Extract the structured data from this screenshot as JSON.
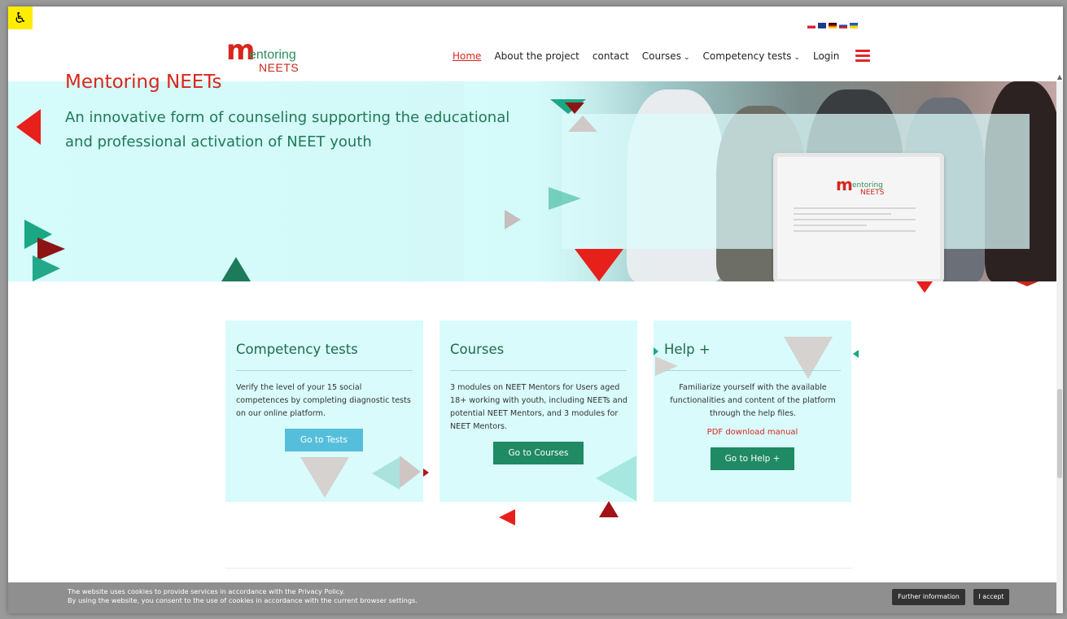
{
  "accessibility": {
    "icon": "wheelchair-icon",
    "glyph": "♿"
  },
  "languages": [
    "pl",
    "gb",
    "de",
    "ru",
    "ua"
  ],
  "logo": {
    "m": "m",
    "line1": "entoring",
    "line2": "NEETS"
  },
  "nav": {
    "items": [
      {
        "label": "Home",
        "active": true
      },
      {
        "label": "About the project"
      },
      {
        "label": "contact"
      },
      {
        "label": "Courses",
        "dropdown": true
      },
      {
        "label": "Competency tests",
        "dropdown": true
      },
      {
        "label": "Login"
      }
    ],
    "chevron": "⌄"
  },
  "hero": {
    "title": "Mentoring NEETs",
    "subtitle": "An innovative form of counseling supporting the educational and professional activation of NEET youth",
    "tablet": {
      "m": "m",
      "line1": "entoring",
      "line2": "NEETS"
    }
  },
  "cards": [
    {
      "title": "Competency tests",
      "text": "Verify the level of your 15 social competences by completing diagnostic tests on our online platform.",
      "button": "Go to Tests",
      "button_color": "#55bfdb"
    },
    {
      "title": "Courses",
      "text": "3 modules on NEET Mentors for Users aged 18+ working with youth, including NEETs and potential NEET Mentors, and 3 modules for NEET Mentors.",
      "button": "Go to Courses",
      "button_color": "#1f8a63"
    },
    {
      "title": "Help +",
      "text": "Familiarize yourself with the available functionalities and content of the platform through the help files.",
      "link": "PDF download manual",
      "button": "Go to Help +",
      "button_color": "#1f8a63"
    }
  ],
  "cookie": {
    "line1": "The website uses cookies to provide services in accordance with the Privacy Policy.",
    "line2": "By using the website, you consent to the use of cookies in accordance with the current browser settings.",
    "more_button": "Further information",
    "accept_button": "I accept"
  },
  "colors": {
    "brand_red": "#d9261c",
    "brand_green": "#1f7a56",
    "hero_bg": "#d5fbfb",
    "card_bg": "#d9fbfb"
  }
}
